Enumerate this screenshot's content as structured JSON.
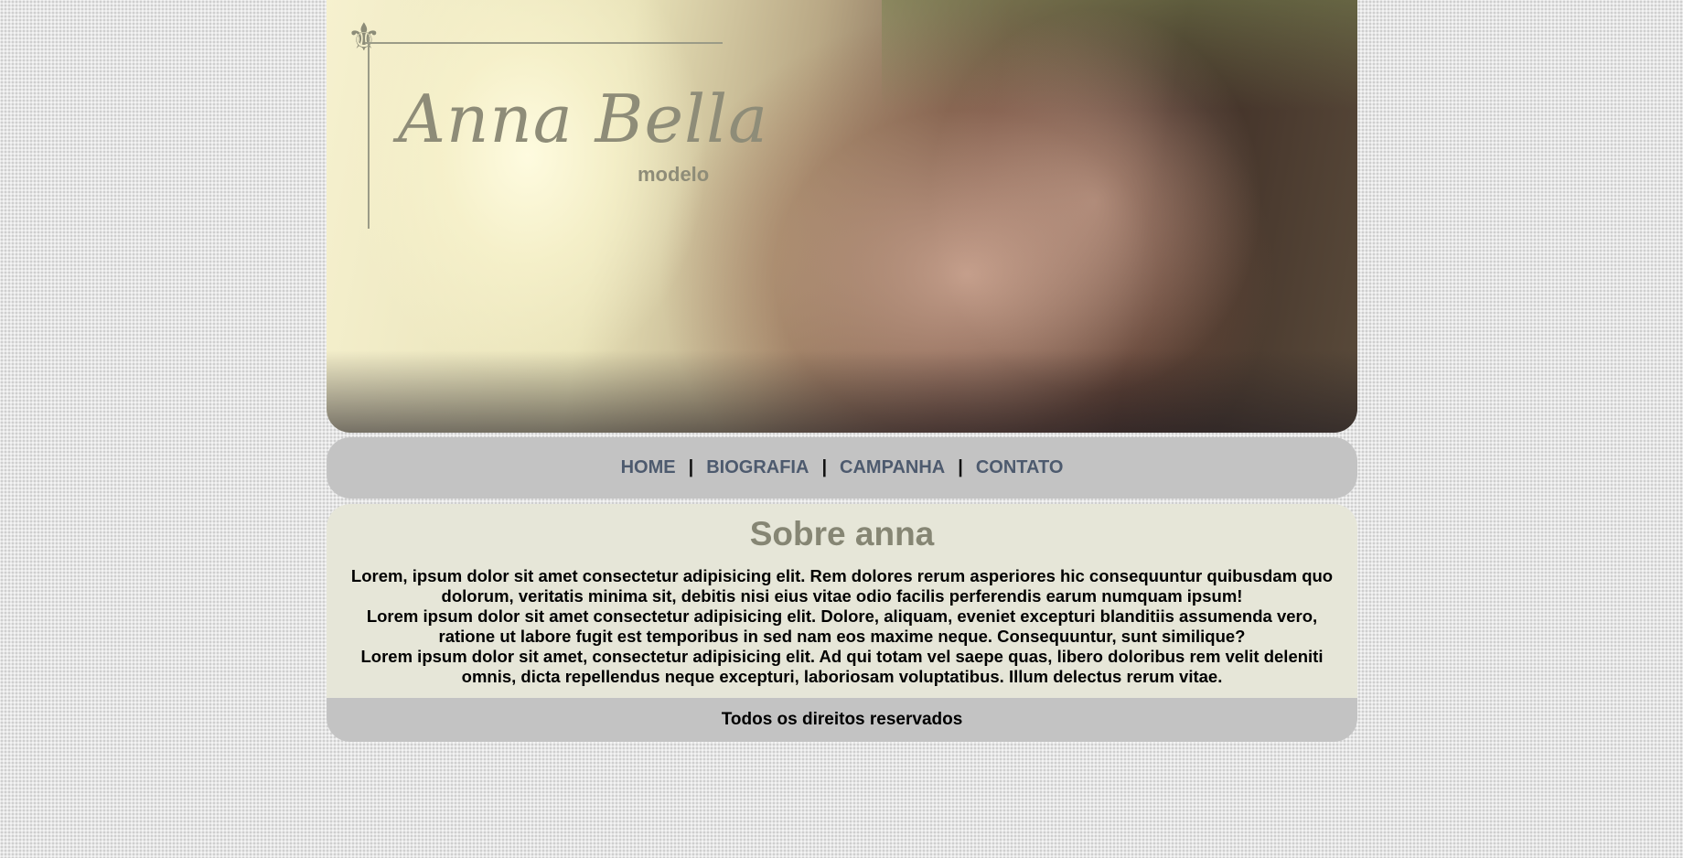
{
  "header": {
    "brand_name": "Anna Bella",
    "brand_subtitle": "modelo",
    "hero_image_alt": "hero-portrait"
  },
  "nav": {
    "items": [
      {
        "label": "HOME"
      },
      {
        "label": "BIOGRAFIA"
      },
      {
        "label": "CAMPANHA"
      },
      {
        "label": "CONTATO"
      }
    ],
    "separator": "|"
  },
  "content": {
    "title": "Sobre anna",
    "paragraphs": [
      "Lorem, ipsum dolor sit amet consectetur adipisicing elit. Rem dolores rerum asperiores hic consequuntur quibusdam quo dolorum, veritatis minima sit, debitis nisi eius vitae odio facilis perferendis earum numquam ipsum!",
      "Lorem ipsum dolor sit amet consectetur adipisicing elit. Dolore, aliquam, eveniet excepturi blanditiis assumenda vero, ratione ut labore fugit est temporibus in sed nam eos maxime neque. Consequuntur, sunt similique?",
      "Lorem ipsum dolor sit amet, consectetur adipisicing elit. Ad qui totam vel saepe quas, libero doloribus rem velit deleniti omnis, dicta repellendus neque excepturi, laboriosam voluptatibus. Illum delectus rerum vitae."
    ]
  },
  "footer": {
    "text": "Todos os direitos reservados"
  },
  "colors": {
    "nav_link": "#4d5a6e",
    "title": "#868674",
    "content_bg": "#e6e6d8",
    "bar_bg": "#c3c3c3"
  }
}
